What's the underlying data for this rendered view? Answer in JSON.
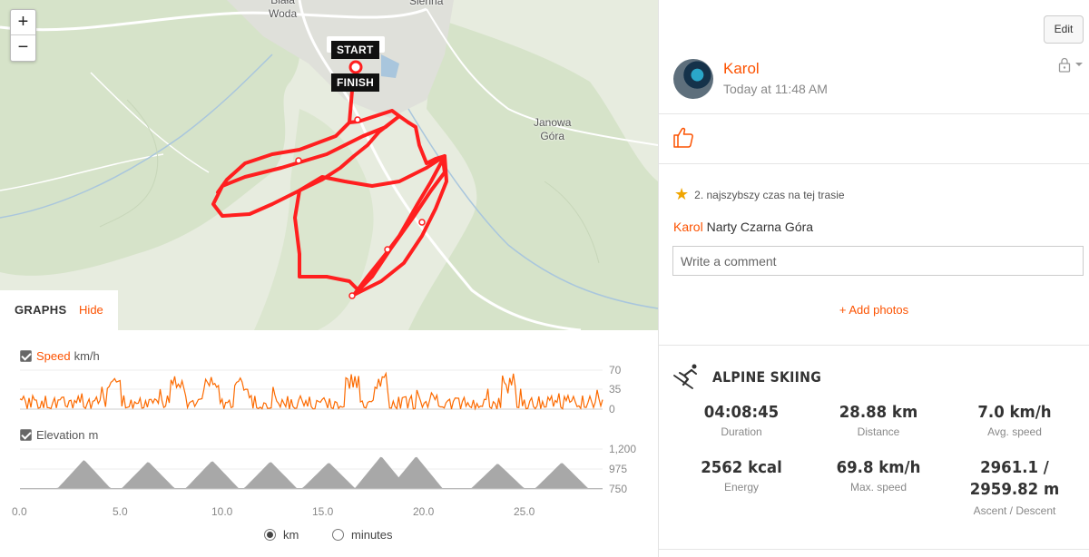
{
  "map": {
    "zoom_in": "+",
    "zoom_out": "−",
    "places": {
      "biala_woda_1": "Biała",
      "biala_woda_2": "Woda",
      "sienna": "Sienna",
      "janowa_gora_1": "Janowa",
      "janowa_gora_2": "Góra"
    },
    "start_label": "START",
    "finish_label": "FINISH",
    "route_color": "#ff1f1f"
  },
  "graphs": {
    "title": "GRAPHS",
    "hide_label": "Hide",
    "speed": {
      "name": "Speed",
      "unit": "km/h",
      "ticks": [
        "70",
        "35",
        "0"
      ]
    },
    "elevation": {
      "name": "Elevation",
      "unit": "m",
      "ticks": [
        "1,200",
        "975",
        "750"
      ]
    },
    "x_ticks": [
      "0.0",
      "5.0",
      "10.0",
      "15.0",
      "20.0",
      "25.0"
    ],
    "units": {
      "km": "km",
      "minutes": "minutes",
      "selected": "km"
    },
    "speed_color": "#fc6a00",
    "elevation_color": "#a8a8a8"
  },
  "sidebar": {
    "edit_label": "Edit",
    "athlete_name": "Karol",
    "timestamp": "Today at 11:48 AM",
    "achievement": "2. najszybszy czas na tej trasie",
    "description_name": "Karol",
    "description_text": "Narty Czarna Góra",
    "comment_placeholder": "Write a comment",
    "add_photos": "+ Add photos",
    "sport": "ALPINE SKIING",
    "stats": [
      {
        "value": "04:08:45",
        "label": "Duration"
      },
      {
        "value": "28.88 km",
        "label": "Distance"
      },
      {
        "value": "7.0 km/h",
        "label": "Avg. speed"
      },
      {
        "value": "2562 kcal",
        "label": "Energy"
      },
      {
        "value": "69.8 km/h",
        "label": "Max. speed"
      },
      {
        "value_line1": "2961.1 /",
        "value_line2": "2959.82 m",
        "label": "Ascent / Descent"
      }
    ],
    "accent": "#fc5200"
  }
}
